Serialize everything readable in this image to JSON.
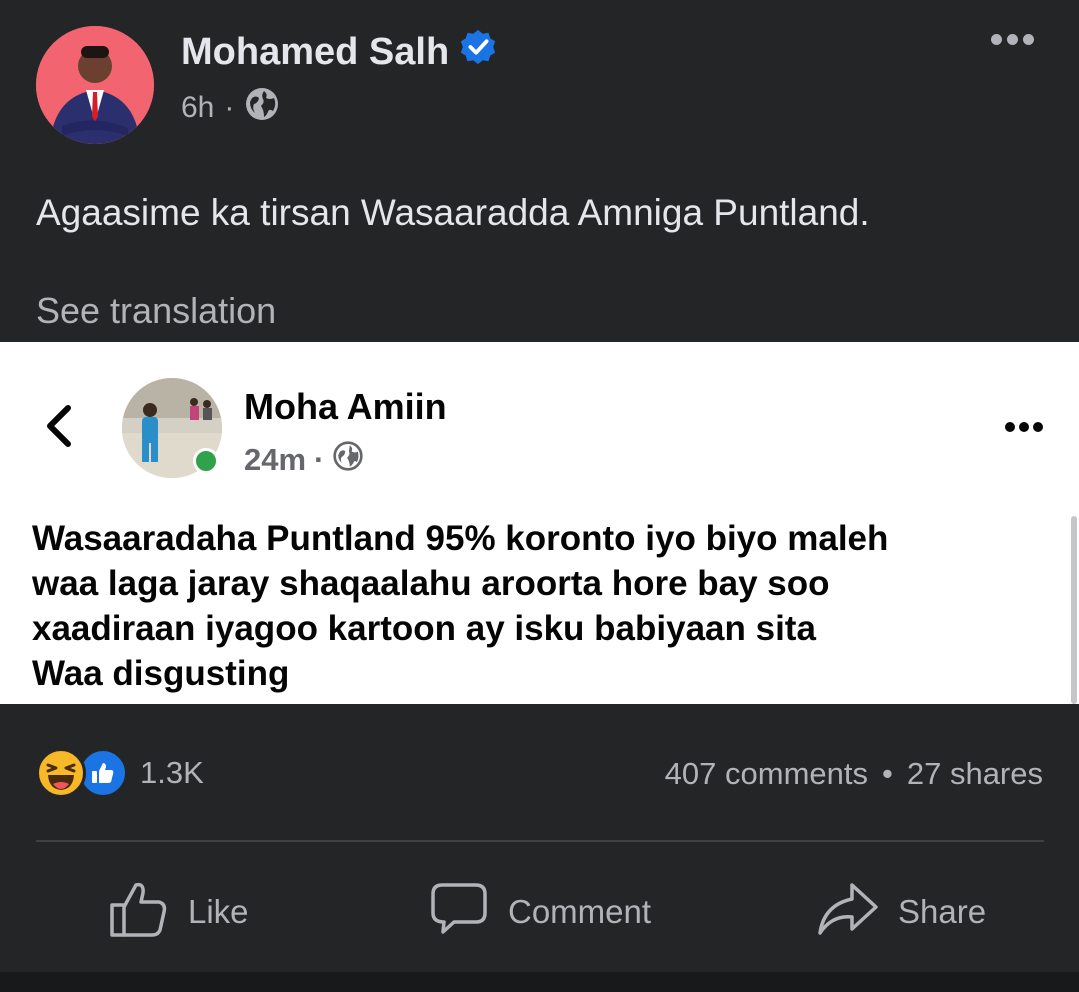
{
  "post": {
    "author": "Mohamed Salh",
    "time": "6h",
    "separator": "·",
    "text": "Agaasime ka tirsan Wasaaradda Amniga Puntland.",
    "see_translation": "See translation"
  },
  "shared": {
    "author": "Moha Amiin",
    "time": "24m",
    "separator": "·",
    "lines": [
      "Wasaaradaha Puntland 95% koronto iyo biyo maleh",
      "waa laga jaray shaqaalahu aroorta hore bay soo",
      "xaadiraan iyagoo kartoon ay isku babiyaan sita",
      "Waa disgusting"
    ]
  },
  "engagement": {
    "reactions_count": "1.3K",
    "comments": "407 comments",
    "dot": "•",
    "shares": "27 shares"
  },
  "actions": {
    "like": "Like",
    "comment": "Comment",
    "share": "Share"
  },
  "icons": {
    "verified": "verified-badge-icon",
    "privacy": "globe-icon",
    "more": "more-options-icon",
    "back": "chevron-left-icon",
    "haha": "haha-reaction-icon",
    "like_reaction": "like-reaction-icon",
    "like_action": "thumbs-up-icon",
    "comment_action": "comment-bubble-icon",
    "share_action": "share-arrow-icon"
  },
  "colors": {
    "background": "#242526",
    "primary_text": "#e4e6eb",
    "secondary_text": "#b0b3b8",
    "accent": "#1b74e4",
    "online": "#31a24c"
  }
}
